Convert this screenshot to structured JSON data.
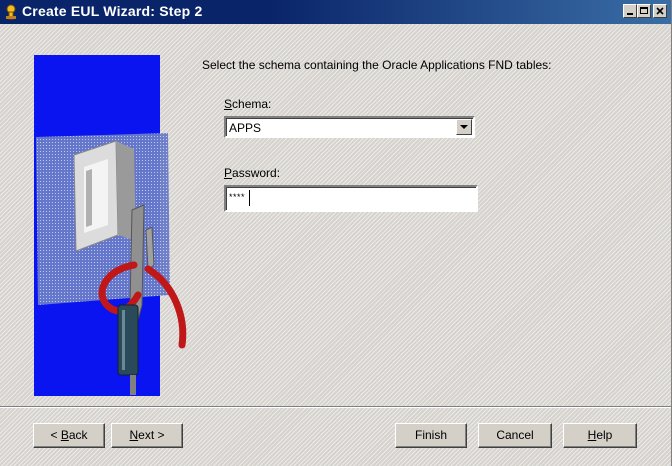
{
  "window": {
    "title": "Create EUL Wizard: Step 2",
    "icon": "wizard-icon",
    "controls": [
      "minimize-icon",
      "maximize-icon",
      "close-icon"
    ]
  },
  "main": {
    "instruction": "Select the schema containing the Oracle Applications FND tables:",
    "schema": {
      "label_accel": "S",
      "label_rest": "chema:",
      "value": "APPS"
    },
    "password": {
      "label_accel": "P",
      "label_rest": "assword:",
      "value": "****"
    }
  },
  "buttons": {
    "back": {
      "prefix": "< ",
      "accel": "B",
      "rest": "ack"
    },
    "next": {
      "prefix": "",
      "accel": "N",
      "rest": "ext >"
    },
    "finish": "Finish",
    "cancel": "Cancel",
    "help": {
      "accel": "H",
      "rest": "elp"
    }
  },
  "colors": {
    "titlebar": "#0a246a",
    "art_background": "#0a14f0",
    "dialog": "#d4d0c8"
  }
}
